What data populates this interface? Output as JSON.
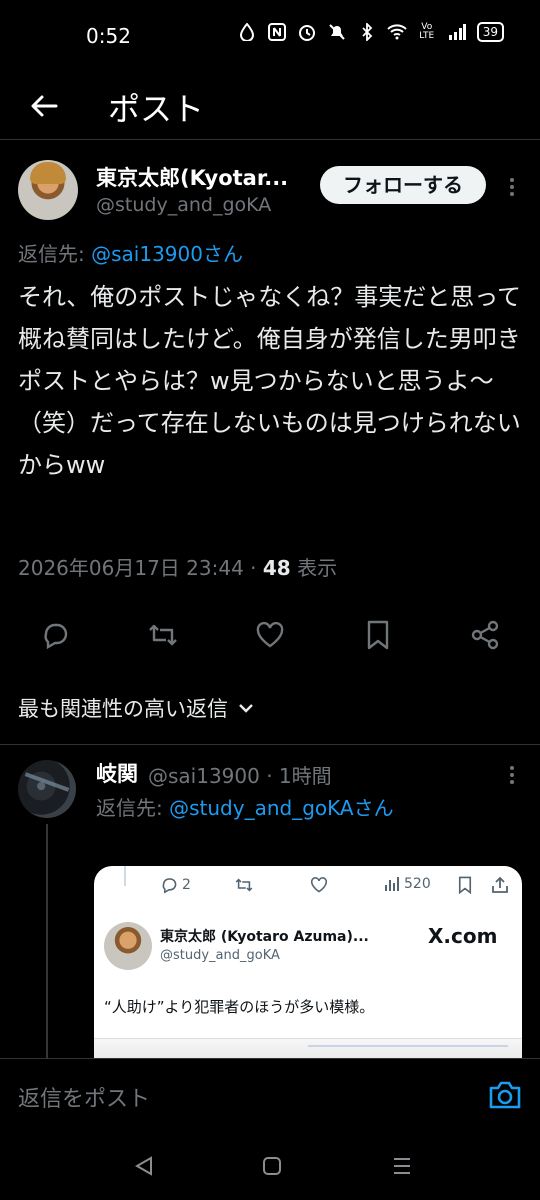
{
  "status_bar": {
    "time": "0:52",
    "battery": "39"
  },
  "header": {
    "title": "ポスト"
  },
  "tweet": {
    "author_name": "東京太郎(Kyotar...",
    "author_handle": "@study_and_goKA",
    "follow_label": "フォローする",
    "reply_to_prefix": "返信先: ",
    "reply_to_mention": "@sai13900さん",
    "text": "それ、俺のポストじゃなくね？事実だと思って概ね賛同はしたけど。俺自身が発信した男叩きポストとやらは？w見つからないと思うよ〜（笑）だって存在しないものは見つけられないからww",
    "timestamp": "2026年06月17日 23:44 · ",
    "views_count": "48",
    "views_label": " 表示"
  },
  "sort": {
    "label": "最も関連性の高い返信"
  },
  "reply": {
    "author_name": "岐関",
    "author_handle": "@sai13900 · 1時間",
    "reply_to_prefix": "返信先: ",
    "reply_to_mention": "@study_and_goKAさん"
  },
  "embed": {
    "reply_count": "2",
    "views": "520",
    "author_name": "東京太郎 (Kyotaro Azuma)...",
    "author_handle": "@study_and_goKA",
    "brand": "X.com",
    "text": "“人助け”より犯罪者のほうが多い模様。"
  },
  "composer": {
    "placeholder": "返信をポスト"
  },
  "colors": {
    "accent": "#1d9bf0",
    "muted": "#71767b",
    "background": "#000000"
  },
  "icons": [
    "arrow-left-icon",
    "reply-icon",
    "retweet-icon",
    "like-icon",
    "bookmark-icon",
    "share-icon",
    "more-icon",
    "camera-icon",
    "chevron-down-icon"
  ]
}
